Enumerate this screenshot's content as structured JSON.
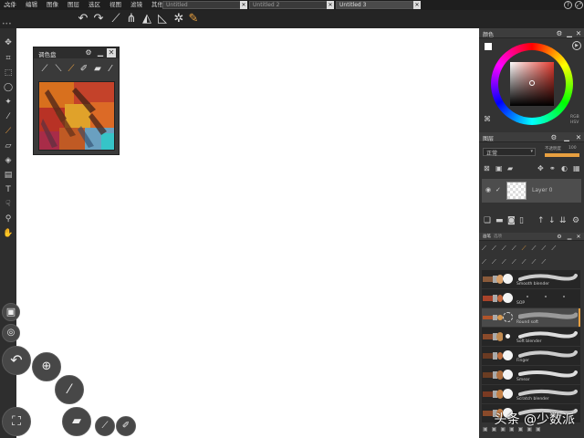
{
  "menubar": {
    "items": [
      "文件",
      "编辑",
      "图像",
      "图层",
      "选区",
      "视图",
      "滤镜",
      "其他"
    ],
    "tabs": [
      "Untitled",
      "Untitled 2",
      "Untitled 3"
    ],
    "help_label": "?"
  },
  "palette": {
    "title": "调色盘"
  },
  "color_panel": {
    "title": "颜色",
    "hue_label": "RGB",
    "mode_label": "HSV",
    "selected_color": "#b42a22"
  },
  "layers_panel": {
    "title": "图层",
    "blend_mode": "正常",
    "opacity_label": "不透明度",
    "opacity_value": "100",
    "layer_name": "Layer 0"
  },
  "brush_panel": {
    "tabs": [
      "画笔",
      "选项"
    ],
    "brushes": [
      "Smooth blender",
      "SOP",
      "Round soft",
      "Soft blender",
      "Finger",
      "Smear",
      "Scratch blender",
      ""
    ]
  },
  "watermark": "头条 @少数派",
  "colors": {
    "accent": "#e8a040"
  }
}
